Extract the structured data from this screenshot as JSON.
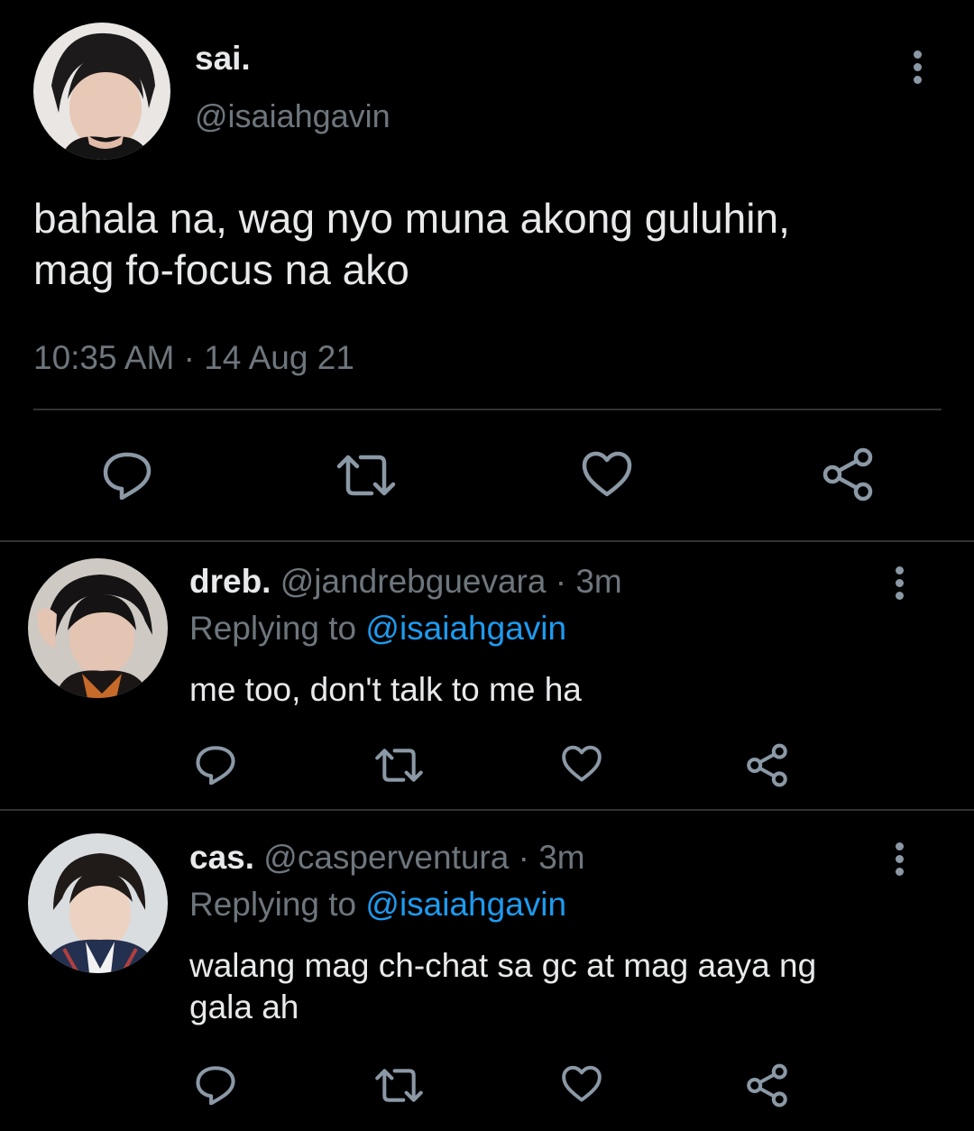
{
  "tweet": {
    "display_name": "sai.",
    "handle": "@isaiahgavin",
    "text_line1": "bahala na, wag nyo muna akong guluhin,",
    "text_line2": "mag fo-focus na ako",
    "time": "10:35 AM",
    "separator": "·",
    "date": "14 Aug 21"
  },
  "replies": [
    {
      "display_name": "dreb.",
      "handle": "@jandrebguevara",
      "dot": "·",
      "time": "3m",
      "replying_label": "Replying to",
      "replying_handle": "@isaiahgavin",
      "text_line1": "me too, don't talk to me ha",
      "text_line2": ""
    },
    {
      "display_name": "cas.",
      "handle": "@casperventura",
      "dot": "·",
      "time": "3m",
      "replying_label": "Replying to",
      "replying_handle": "@isaiahgavin",
      "text_line1": "walang mag ch-chat sa gc at mag aaya ng",
      "text_line2": "gala ah"
    }
  ],
  "icons": {
    "reply": "reply-icon",
    "retweet": "retweet-icon",
    "like": "heart-icon",
    "share": "share-icon",
    "more": "more-vertical-icon"
  },
  "colors": {
    "background": "#000000",
    "text": "#e7e9ea",
    "muted": "#6e767d",
    "link": "#1d9bf0",
    "icon": "#8b98a5",
    "divider": "#2f3336"
  }
}
